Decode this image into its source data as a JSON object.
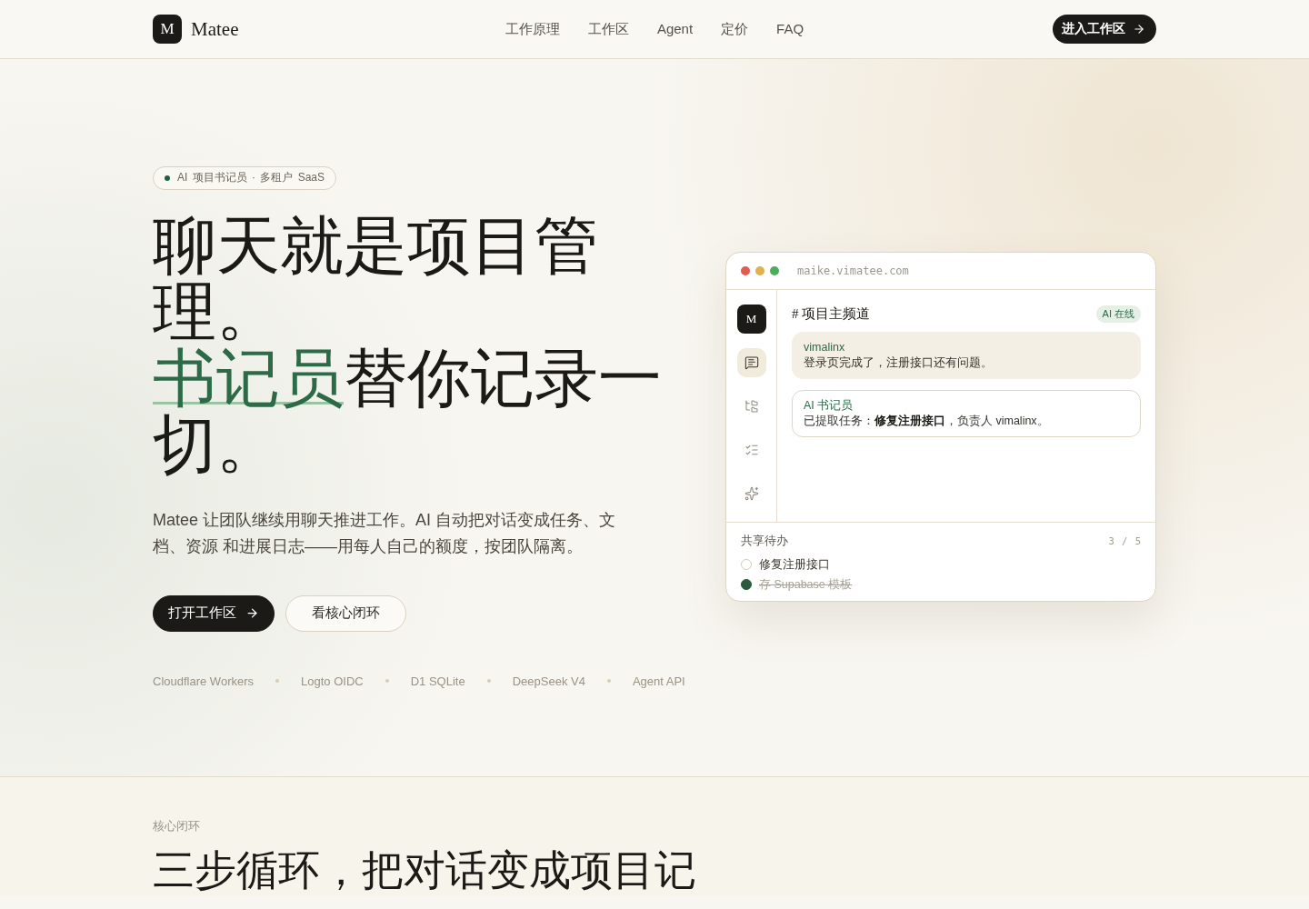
{
  "header": {
    "logo": {
      "mark": "M",
      "name": "Matee"
    },
    "nav": [
      "工作原理",
      "工作区",
      "Agent",
      "定价",
      "FAQ"
    ],
    "cta": "进入工作区"
  },
  "hero": {
    "badge": "AI 项目书记员 · 多租户 SaaS",
    "headline": {
      "lead": "聊天就是项目管理。",
      "highlight": "书记员",
      "rest": "替你记录一切。"
    },
    "description": "Matee 让团队继续用聊天推进工作。AI 自动把对话变成任务、文档、资源 和进展日志——用每人自己的额度，按团队隔离。",
    "buttons": [
      {
        "label": "打开工作区",
        "kind": "primary"
      },
      {
        "label": "看核心闭环",
        "kind": "secondary"
      }
    ],
    "stack": [
      "Cloudflare Workers",
      "Logto OIDC",
      "D1 SQLite",
      "DeepSeek V4",
      "Agent API"
    ]
  },
  "preview": {
    "url": "maike.vimatee.com",
    "sidebar": {
      "logo": "M",
      "items": [
        {
          "kind": "chat",
          "selected": true
        },
        {
          "kind": "tree",
          "selected": false
        },
        {
          "kind": "checklist",
          "selected": false
        },
        {
          "kind": "sparkles",
          "selected": false
        }
      ]
    },
    "channel": {
      "title": "# 项目主频道",
      "status": "AI 在线",
      "messages": [
        {
          "kind": "user",
          "author": "vimalinx",
          "text": "登录页完成了，注册接口还有问题。"
        },
        {
          "kind": "ai",
          "author": "AI 书记员",
          "text": "已提取任务：**修复注册接口**，负责人 vimalinx。"
        }
      ]
    },
    "todos": {
      "title": "共享待办",
      "count": "3 / 5",
      "items": [
        {
          "label": "修复注册接口",
          "checked": false
        },
        {
          "label": "存 Supabase 模板",
          "checked": true
        }
      ]
    }
  },
  "loop_section": {
    "eyebrow": "核心闭环",
    "heading": "三步循环，把对话变成项目记"
  }
}
